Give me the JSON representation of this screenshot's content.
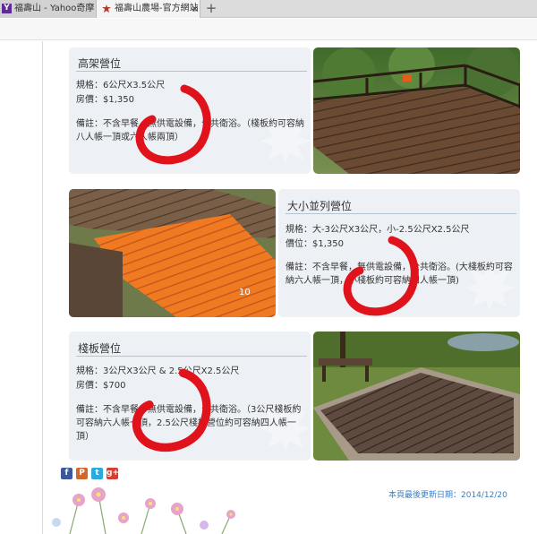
{
  "browser": {
    "tabs": [
      {
        "label": "福壽山 - Yahoo奇摩 搜尋結果",
        "favicon": "yahoo-icon"
      },
      {
        "label": "福壽山農場-官方網站",
        "favicon": "leaf-icon",
        "close": "×"
      }
    ],
    "new_tab": "+"
  },
  "campsites": [
    {
      "title": "高架營位",
      "spec": "規格：6公尺X3.5公尺",
      "price": "房價：$1,350",
      "note": "備註：不含早餐，無供電設備，公共衛浴。（棧板約可容納八人帳一頂或六人帳兩頂）"
    },
    {
      "title": "大小並列營位",
      "spec": "規格：大-3公尺X3公尺，小-2.5公尺X2.5公尺",
      "price": "價位：$1,350",
      "note": "備註：不含早餐，無供電設備，公共衛浴。(大棧板約可容納六人帳一頂，小棧板約可容納四人帳一頂)"
    },
    {
      "title": "棧板營位",
      "spec": "規格：3公尺X3公尺 & 2.5公尺X2.5公尺",
      "price": "房價：$700",
      "note": "備註：不含早餐，無供電設備，公共衛浴。（3公尺棧板約可容納六人帳一頂，2.5公尺棧板營位約可容納四人帳一頂）"
    }
  ],
  "social": [
    {
      "icon": "facebook-icon",
      "glyph": "f",
      "color": "#3b5998"
    },
    {
      "icon": "plurk-icon",
      "glyph": "P",
      "color": "#cf682f"
    },
    {
      "icon": "twitter-icon",
      "glyph": "t",
      "color": "#2aa9e0"
    },
    {
      "icon": "googleplus-icon",
      "glyph": "g+",
      "color": "#d73d32"
    }
  ],
  "footer": {
    "last_updated": "本頁最後更新日期：2014/12/20"
  },
  "colors": {
    "accent_link": "#3a7ec2",
    "card_bg": "#edf1f5",
    "annotation_red": "#e0121b"
  }
}
